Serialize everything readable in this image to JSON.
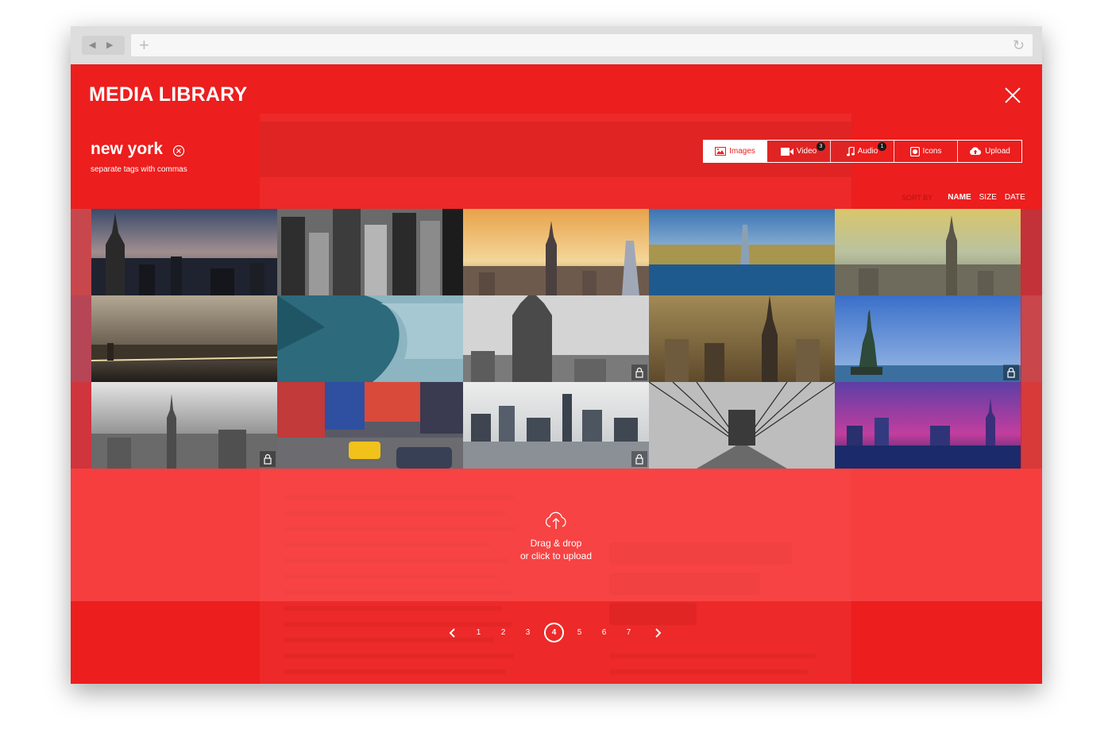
{
  "app": {
    "title": "MEDIA LIBRARY",
    "accent_color": "#ec1e1e"
  },
  "search": {
    "tag": "new york",
    "hint": "separate tags with commas"
  },
  "tabs": [
    {
      "label": "Images",
      "icon": "image-icon",
      "active": true
    },
    {
      "label": "Video",
      "icon": "video-camera-icon",
      "badge": "3"
    },
    {
      "label": "Audio",
      "icon": "music-note-icon",
      "badge": "1"
    },
    {
      "label": "Icons",
      "icon": "icons-square-icon"
    },
    {
      "label": "Upload",
      "icon": "cloud-upload-icon"
    }
  ],
  "sort": {
    "label": "SORT BY",
    "options": [
      "NAME",
      "SIZE",
      "DATE"
    ],
    "active": "NAME"
  },
  "dropzone": {
    "line1": "Drag & drop",
    "line2": "or click to upload",
    "icon": "cloud-upload-icon"
  },
  "pagination": {
    "pages": [
      "1",
      "2",
      "3",
      "4",
      "5",
      "6",
      "7"
    ],
    "current": "4"
  }
}
